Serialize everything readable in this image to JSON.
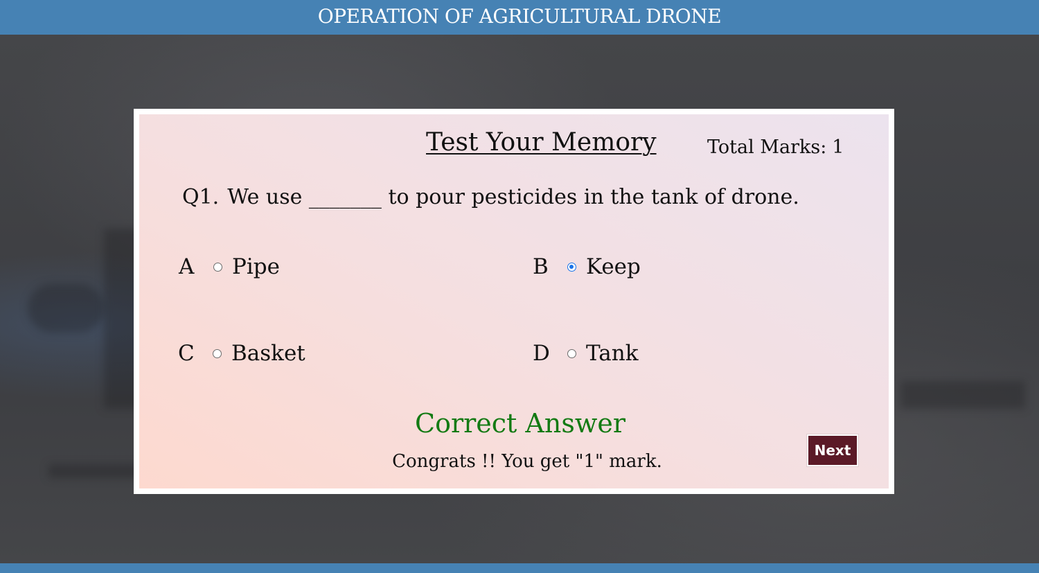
{
  "header": {
    "title": "OPERATION OF AGRICULTURAL DRONE"
  },
  "quiz": {
    "title": "Test Your Memory",
    "total_marks_label": "Total Marks:",
    "total_marks_value": "1",
    "question": {
      "number": "Q1.",
      "text": "We use _______ to pour pesticides in the tank of drone."
    },
    "options": [
      {
        "letter": "A",
        "label": "Pipe",
        "selected": false
      },
      {
        "letter": "B",
        "label": "Keep",
        "selected": true
      },
      {
        "letter": "C",
        "label": "Basket",
        "selected": false
      },
      {
        "letter": "D",
        "label": "Tank",
        "selected": false
      }
    ],
    "feedback": {
      "title": "Correct Answer",
      "message": "Congrats !! You get \"1\" mark."
    },
    "next_label": "Next"
  },
  "colors": {
    "header_bg": "#4682b4",
    "correct_green": "#137a13",
    "next_button_bg": "#5b1a27",
    "radio_checked": "#1a73e8"
  }
}
